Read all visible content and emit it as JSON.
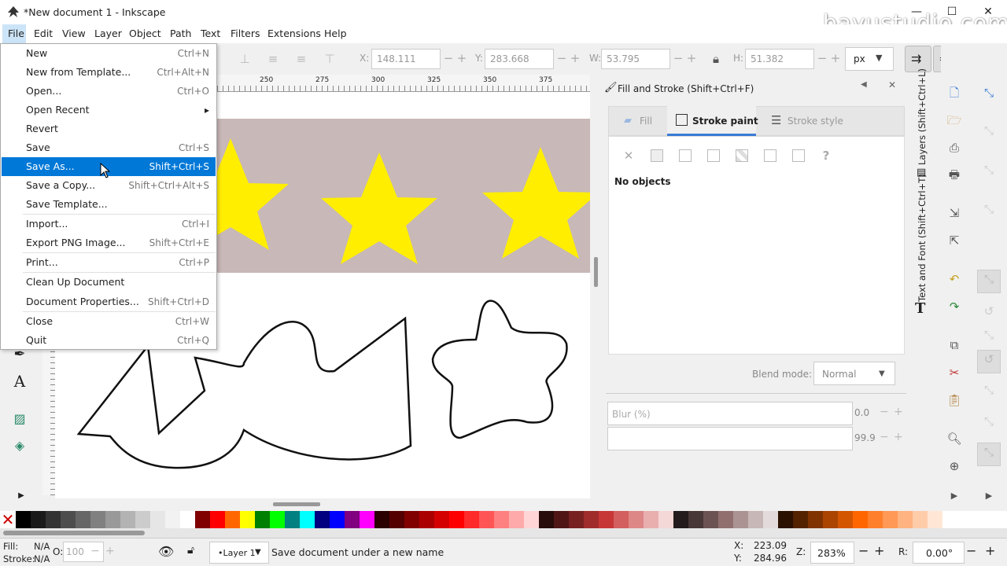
{
  "window": {
    "title": "*New document 1 - Inkscape",
    "watermark": "bayustudio.com",
    "minimize": "—",
    "maximize": "☐",
    "close": "✕"
  },
  "menubar": [
    "File",
    "Edit",
    "View",
    "Layer",
    "Object",
    "Path",
    "Text",
    "Filters",
    "Extensions",
    "Help"
  ],
  "file_menu": [
    {
      "label": "New",
      "shortcut": "Ctrl+N"
    },
    {
      "label": "New from Template...",
      "shortcut": "Ctrl+Alt+N"
    },
    {
      "label": "Open...",
      "shortcut": "Ctrl+O"
    },
    {
      "label": "Open Recent",
      "shortcut": "▸"
    },
    {
      "label": "Revert",
      "shortcut": ""
    },
    {
      "label": "Save",
      "shortcut": "Ctrl+S"
    },
    {
      "label": "Save As...",
      "shortcut": "Shift+Ctrl+S"
    },
    {
      "label": "Save a Copy...",
      "shortcut": "Shift+Ctrl+Alt+S"
    },
    {
      "label": "Save Template...",
      "shortcut": ""
    },
    {
      "label": "Import...",
      "shortcut": "Ctrl+I"
    },
    {
      "label": "Export PNG Image...",
      "shortcut": "Shift+Ctrl+E"
    },
    {
      "label": "Print...",
      "shortcut": "Ctrl+P"
    },
    {
      "label": "Clean Up Document",
      "shortcut": ""
    },
    {
      "label": "Document Properties...",
      "shortcut": "Shift+Ctrl+D"
    },
    {
      "label": "Close",
      "shortcut": "Ctrl+W"
    },
    {
      "label": "Quit",
      "shortcut": "Ctrl+Q"
    }
  ],
  "toolbar": {
    "x_label": "X:",
    "x_value": "148.111",
    "y_label": "Y:",
    "y_value": "283.668",
    "w_label": "W:",
    "w_value": "53.795",
    "h_label": "H:",
    "h_value": "51.382",
    "unit": "px",
    "minus": "−",
    "plus": "+"
  },
  "ruler": [
    "250",
    "275",
    "300",
    "325",
    "350",
    "375"
  ],
  "dock": {
    "title": "Fill and Stroke (Shift+Ctrl+F)",
    "tabs": [
      "Fill",
      "Stroke paint",
      "Stroke style"
    ],
    "no_objects": "No objects",
    "blend_label": "Blend mode:",
    "blend_value": "Normal",
    "blur_label": "Blur (%)",
    "blur_value": "0.0",
    "opacity_value": "99.9"
  },
  "vertical_tabs": {
    "layers": "Layers (Shift+Ctrl+L)",
    "text_font": "Text and Font (Shift+Ctrl+T)"
  },
  "palette_colors": [
    "#000000",
    "#1a1a1a",
    "#333333",
    "#4d4d4d",
    "#666666",
    "#808080",
    "#999999",
    "#b3b3b3",
    "#cccccc",
    "#e6e6e6",
    "#f2f2f2",
    "#ffffff",
    "#800000",
    "#ff0000",
    "#ff6600",
    "#ffff00",
    "#008000",
    "#00ff00",
    "#008080",
    "#00ffff",
    "#000080",
    "#0000ff",
    "#800080",
    "#ff00ff",
    "#2b0000",
    "#550000",
    "#800000",
    "#aa0000",
    "#d40000",
    "#ff0000",
    "#ff2a2a",
    "#ff5555",
    "#ff8080",
    "#ffaaaa",
    "#ffd5d5",
    "#280b0b",
    "#501616",
    "#782121",
    "#a02c2c",
    "#c83737",
    "#d35f5f",
    "#de8787",
    "#e9afaf",
    "#f4d7d7",
    "#241c1c",
    "#483737",
    "#6c5353",
    "#916f6f",
    "#ac9393",
    "#c8b7b7",
    "#e3dbdb",
    "#2b1100",
    "#552200",
    "#803300",
    "#aa4400",
    "#d45500",
    "#ff6600",
    "#ff7f2a",
    "#ff9955",
    "#ffb380",
    "#ffccaa",
    "#ffe6d5"
  ],
  "status": {
    "fill_label": "Fill:",
    "fill_value": "N/A",
    "stroke_label": "Stroke:",
    "stroke_value": "N/A",
    "opacity_label": "O:",
    "opacity_value": "100",
    "layer": "•Layer 1",
    "message": "Save document under a new name",
    "x_label": "X:",
    "x_value": "223.09",
    "y_label": "Y:",
    "y_value": "284.96",
    "zoom_label": "Z:",
    "zoom_value": "283%",
    "rot_label": "R:",
    "rot_value": "0.00°"
  },
  "colors": {
    "star": "#ffee00",
    "band": "#c8b8b7",
    "accent": "#0078d7"
  }
}
